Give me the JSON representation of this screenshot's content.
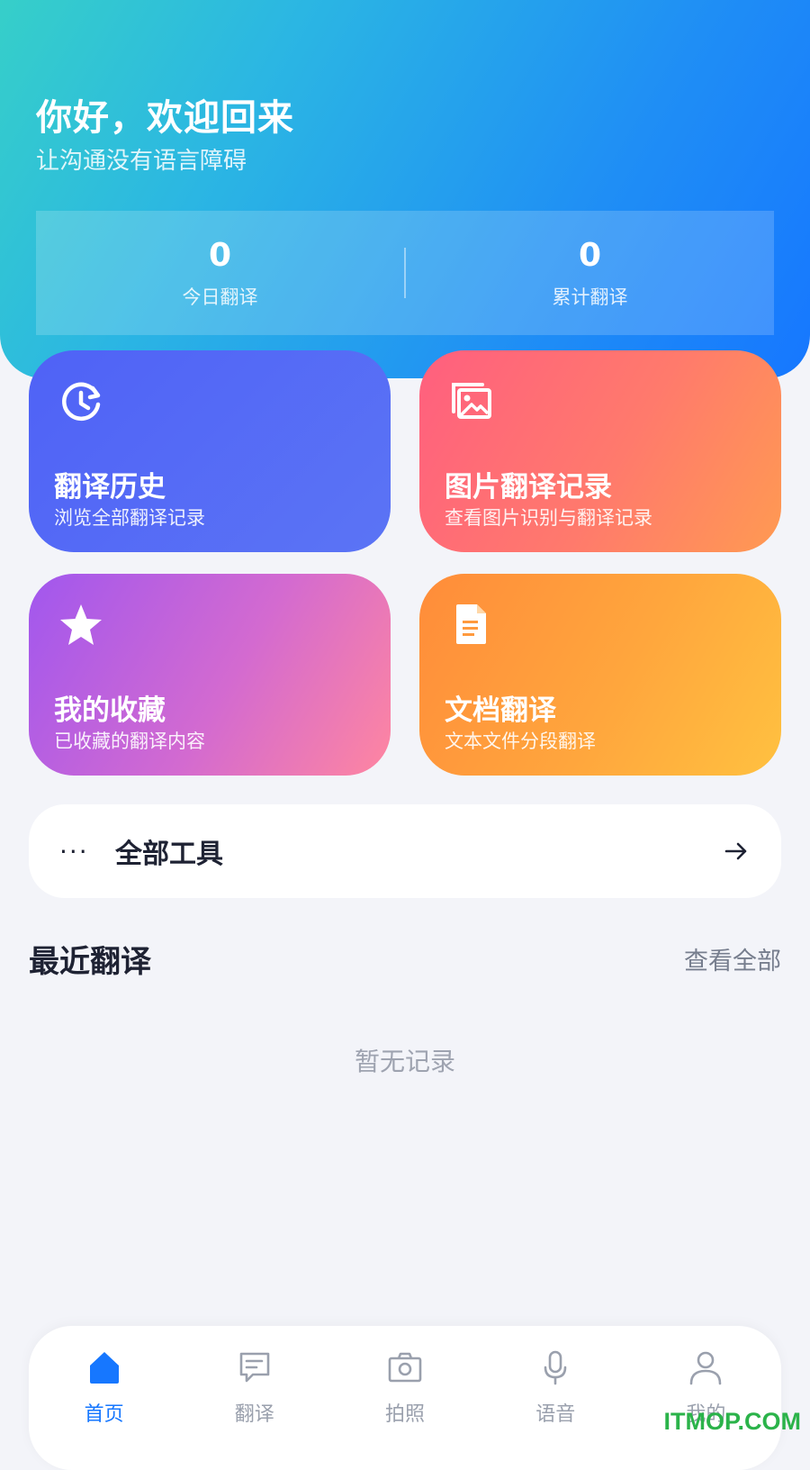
{
  "header": {
    "greeting": "你好，欢迎回来",
    "subtitle": "让沟通没有语言障碍",
    "stats": [
      {
        "value": "0",
        "label": "今日翻译"
      },
      {
        "value": "0",
        "label": "累计翻译"
      }
    ]
  },
  "cards": [
    {
      "title": "翻译历史",
      "desc": "浏览全部翻译记录",
      "icon": "history-icon"
    },
    {
      "title": "图片翻译记录",
      "desc": "查看图片识别与翻译记录",
      "icon": "image-icon"
    },
    {
      "title": "我的收藏",
      "desc": "已收藏的翻译内容",
      "icon": "star-icon"
    },
    {
      "title": "文档翻译",
      "desc": "文本文件分段翻译",
      "icon": "document-icon"
    }
  ],
  "tools": {
    "dots": "···",
    "label": "全部工具"
  },
  "recent": {
    "title": "最近翻译",
    "view_all": "查看全部",
    "empty": "暂无记录"
  },
  "tabbar": [
    {
      "label": "首页",
      "icon": "home-icon",
      "active": true
    },
    {
      "label": "翻译",
      "icon": "chat-icon",
      "active": false
    },
    {
      "label": "拍照",
      "icon": "camera-icon",
      "active": false
    },
    {
      "label": "语音",
      "icon": "microphone-icon",
      "active": false
    },
    {
      "label": "我的",
      "icon": "user-icon",
      "active": false
    }
  ],
  "colors": {
    "accent": "#1677ff",
    "inactive": "#9aa0ad"
  },
  "watermark": "ITMOP.COM"
}
